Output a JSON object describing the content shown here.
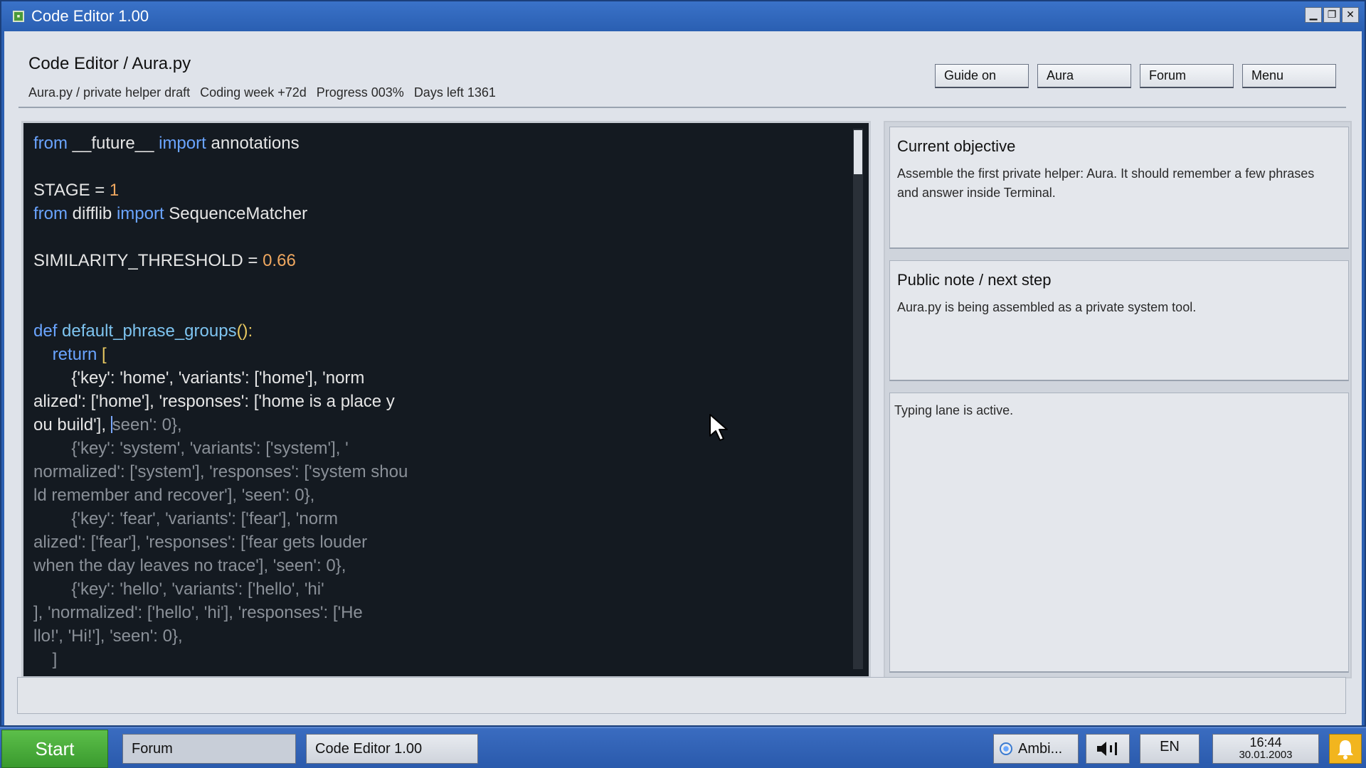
{
  "window": {
    "title": "Code Editor 1.00",
    "icon": "app-icon",
    "controls": [
      "minimize-icon",
      "maximize-icon",
      "close-icon"
    ]
  },
  "header": {
    "title": "Code Editor / Aura.py",
    "meta": [
      "Aura.py / private helper draft",
      "Coding week +72d",
      "Progress 003%",
      "Days left 1361"
    ],
    "progress_percent": 3,
    "buttons": [
      "Guide on",
      "Aura",
      "Forum",
      "Menu"
    ]
  },
  "editor": {
    "lines": [
      [
        {
          "t": "from",
          "c": "kw"
        },
        {
          "t": " __future__ ",
          "c": ""
        },
        {
          "t": "import",
          "c": "kw"
        },
        {
          "t": " annotations",
          "c": ""
        }
      ],
      [],
      [
        {
          "t": "STAGE = ",
          "c": ""
        },
        {
          "t": "1",
          "c": "num"
        }
      ],
      [
        {
          "t": "from",
          "c": "kw"
        },
        {
          "t": " difflib ",
          "c": ""
        },
        {
          "t": "import",
          "c": "kw"
        },
        {
          "t": " SequenceMatcher",
          "c": ""
        }
      ],
      [],
      [
        {
          "t": "SIMILARITY_THRESHOLD = ",
          "c": ""
        },
        {
          "t": "0.66",
          "c": "num"
        }
      ],
      [],
      [],
      [
        {
          "t": "def",
          "c": "kw"
        },
        {
          "t": " default_phrase_groups",
          "c": "fn"
        },
        {
          "t": "():",
          "c": "br"
        }
      ],
      [
        {
          "t": "    return",
          "c": "kw"
        },
        {
          "t": " [",
          "c": "br"
        }
      ],
      [
        {
          "t": "        {'key': 'home', 'variants': ['home'], 'norm",
          "c": ""
        }
      ],
      [
        {
          "t": "alized': ['home'], 'responses': ['home is a place y",
          "c": ""
        }
      ],
      [
        {
          "t": "ou build'], ",
          "c": ""
        },
        {
          "t": "|",
          "c": "caret"
        },
        {
          "t": "seen': 0},",
          "c": "dim"
        }
      ],
      [
        {
          "t": "        {'key': 'system', 'variants': ['system'], '",
          "c": "dim"
        }
      ],
      [
        {
          "t": "normalized': ['system'], 'responses': ['system shou",
          "c": "dim"
        }
      ],
      [
        {
          "t": "ld remember and recover'], 'seen': 0},",
          "c": "dim"
        }
      ],
      [
        {
          "t": "        {'key': 'fear', 'variants': ['fear'], 'norm",
          "c": "dim"
        }
      ],
      [
        {
          "t": "alized': ['fear'], 'responses': ['fear gets louder",
          "c": "dim"
        }
      ],
      [
        {
          "t": "when the day leaves no trace'], 'seen': 0},",
          "c": "dim"
        }
      ],
      [
        {
          "t": "        {'key': 'hello', 'variants': ['hello', 'hi'",
          "c": "dim"
        }
      ],
      [
        {
          "t": "], 'normalized': ['hello', 'hi'], 'responses': ['He",
          "c": "dim"
        }
      ],
      [
        {
          "t": "llo!', 'Hi!'], 'seen': 0},",
          "c": "dim"
        }
      ],
      [
        {
          "t": "    ]",
          "c": "dim"
        }
      ]
    ]
  },
  "objective": {
    "title": "Current objective",
    "body": "Assemble the first private helper: Aura. It should remember a few phrases and answer inside Terminal."
  },
  "note": {
    "title": "Public note / next step",
    "body": "Aura.py is being assembled as a private system tool."
  },
  "lane": {
    "text": "Typing lane is active."
  },
  "taskbar": {
    "start": "Start",
    "tasks": [
      "Forum",
      "Code Editor 1.00"
    ],
    "ambi": "Ambi...",
    "lang": "EN",
    "time": "16:44",
    "date": "30.01.2003"
  },
  "colors": {
    "titlebar": "#2a5fb2",
    "editor_bg": "#141a21",
    "keyword": "#6aa4ff",
    "number": "#f0a860",
    "start_green": "#4caf3e",
    "bell": "#f2b51e"
  }
}
